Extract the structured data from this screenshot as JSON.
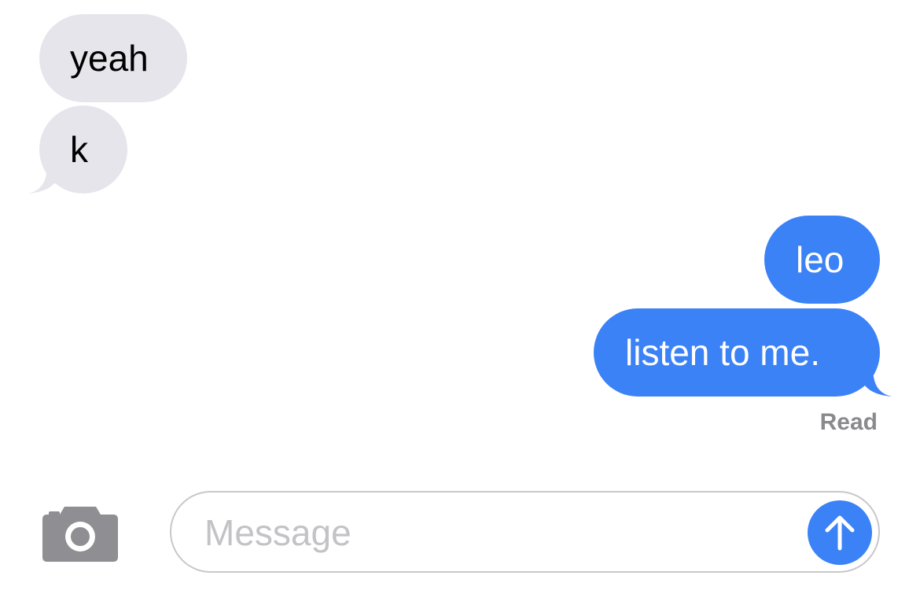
{
  "conversation": {
    "messages": [
      {
        "direction": "incoming",
        "text": "yeah"
      },
      {
        "direction": "incoming",
        "text": "k"
      },
      {
        "direction": "outgoing",
        "text": "leo"
      },
      {
        "direction": "outgoing",
        "text": "listen to me."
      }
    ],
    "read_receipt": "Read"
  },
  "composer": {
    "placeholder": "Message",
    "value": "",
    "camera_icon": "camera-icon",
    "send_icon": "arrow-up-icon"
  },
  "colors": {
    "incoming_bubble": "#e6e5eb",
    "outgoing_bubble": "#3b82f7",
    "read_receipt": "#8a8a8e",
    "placeholder": "#c3c3c7",
    "camera_icon": "#8e8e93"
  }
}
